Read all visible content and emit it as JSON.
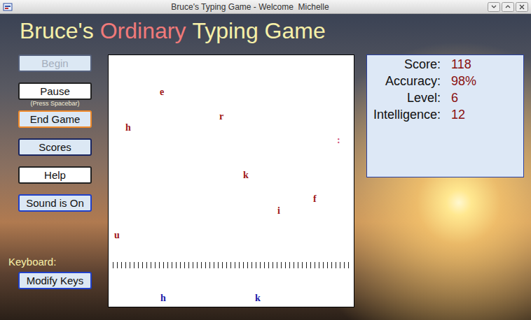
{
  "window": {
    "title": "Bruce's Typing Game - Welcome  Michelle"
  },
  "heading": [
    {
      "text": "Bruce's",
      "color": "#f6f0a8"
    },
    {
      "text": "Ordinary",
      "color": "#f07a7a"
    },
    {
      "text": "Typing Game",
      "color": "#f6f0a8"
    }
  ],
  "buttons": [
    {
      "label": "Begin",
      "disabled": true,
      "highlighted": false,
      "focused": false,
      "accent": false,
      "hint": ""
    },
    {
      "label": "Pause",
      "disabled": false,
      "highlighted": true,
      "focused": false,
      "accent": false,
      "hint": "(Press Spacebar)"
    },
    {
      "label": "End Game",
      "disabled": false,
      "highlighted": false,
      "focused": true,
      "accent": false,
      "hint": ""
    },
    {
      "label": "Scores",
      "disabled": false,
      "highlighted": false,
      "focused": false,
      "accent": false,
      "hint": ""
    },
    {
      "label": "Help",
      "disabled": false,
      "highlighted": true,
      "focused": false,
      "accent": false,
      "hint": ""
    },
    {
      "label": "Sound is On",
      "disabled": false,
      "highlighted": false,
      "focused": false,
      "accent": true,
      "hint": ""
    }
  ],
  "keyboard": {
    "label": "Keyboard:",
    "button": {
      "label": "Modify Keys",
      "disabled": false,
      "highlighted": false,
      "focused": false,
      "accent": true
    }
  },
  "game": {
    "falling_letters": [
      {
        "char": "e",
        "color": "#a01818"
      },
      {
        "char": "r",
        "color": "#a01818"
      },
      {
        "char": "h",
        "color": "#a01818"
      },
      {
        "char": ":",
        "color": "#d0507a"
      },
      {
        "char": "k",
        "color": "#a01818"
      },
      {
        "char": "f",
        "color": "#a01818"
      },
      {
        "char": "i",
        "color": "#a01818"
      },
      {
        "char": "u",
        "color": "#a01818"
      }
    ],
    "base_letters": [
      {
        "char": "h",
        "color": "#1a1aa8"
      },
      {
        "char": "k",
        "color": "#1a1aa8"
      }
    ]
  },
  "stats": [
    {
      "label": "Score:",
      "value": "118"
    },
    {
      "label": "Accuracy:",
      "value": "98%"
    },
    {
      "label": "Level:",
      "value": "6"
    },
    {
      "label": "Intelligence:",
      "value": "12"
    }
  ]
}
